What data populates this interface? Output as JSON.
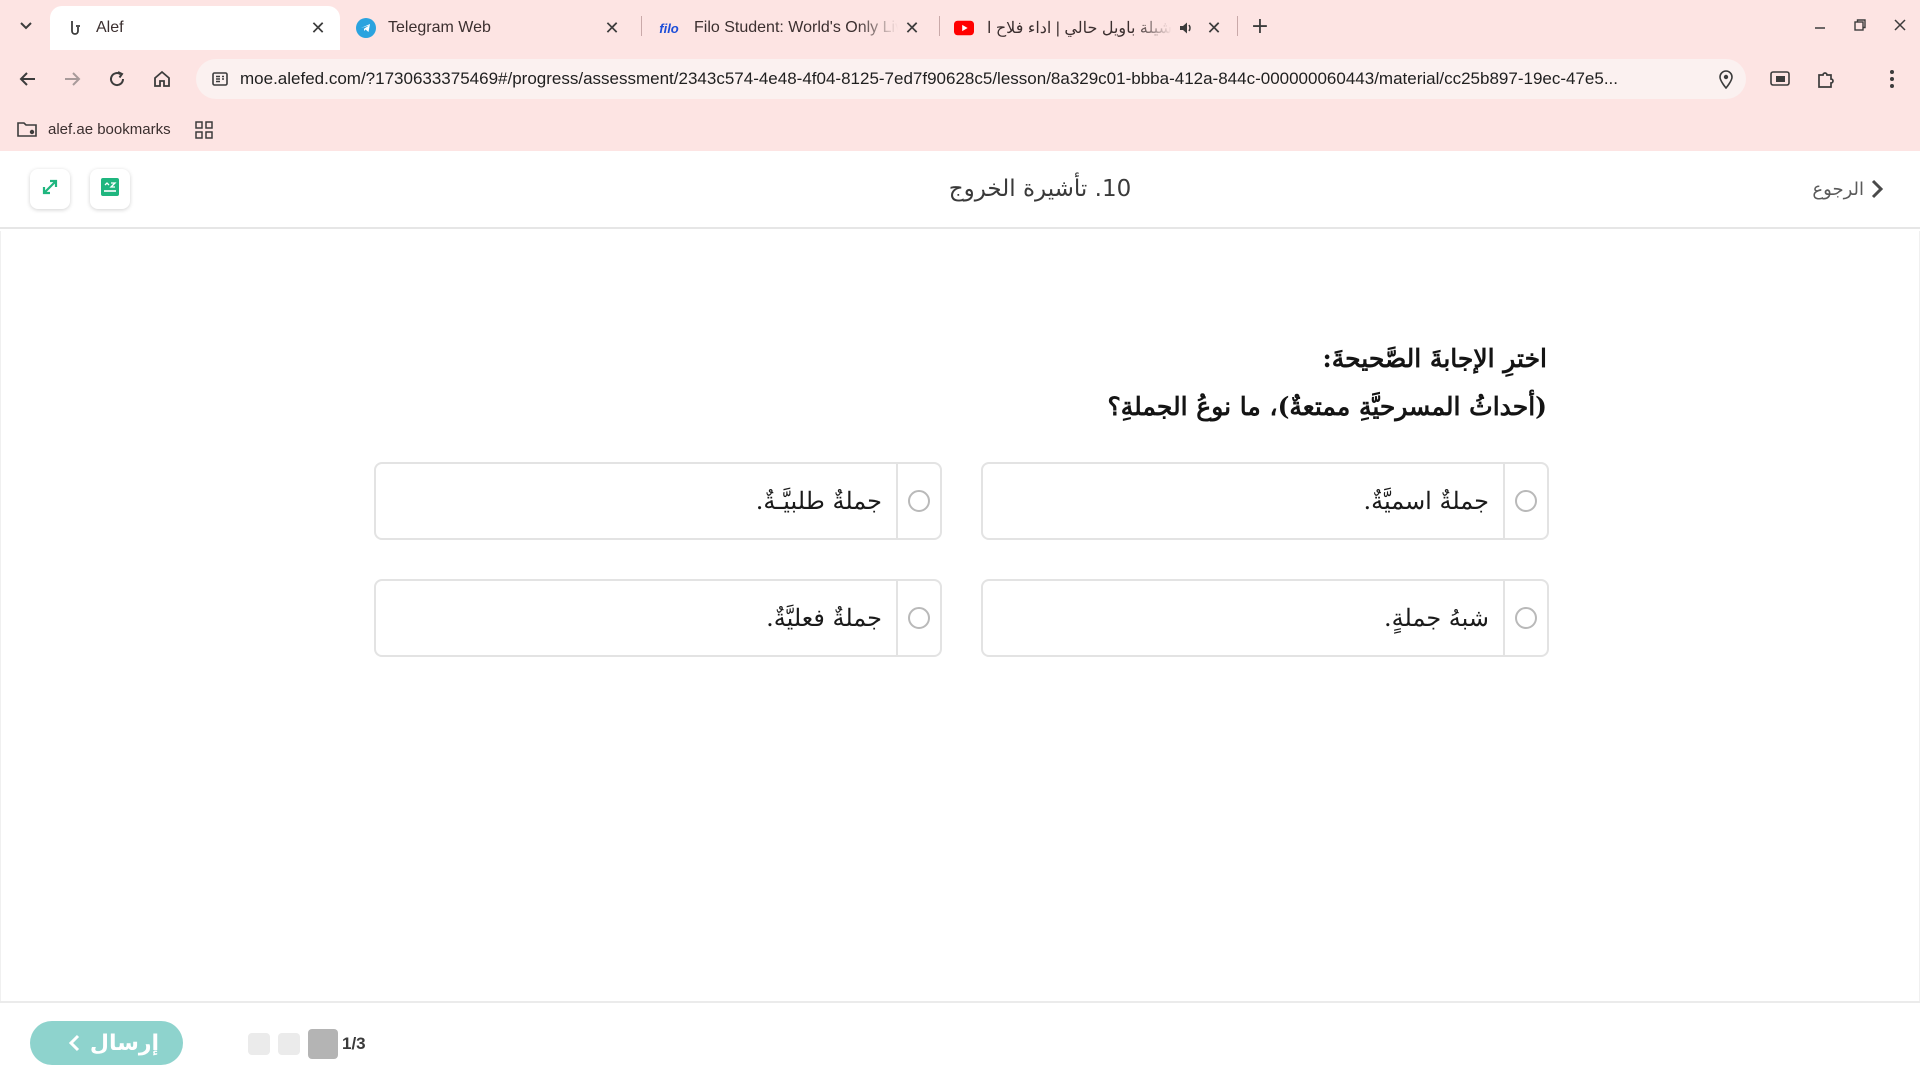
{
  "browser": {
    "tabs": [
      {
        "title": "Alef",
        "icon": "alef-logo-icon",
        "active": true
      },
      {
        "title": "Telegram Web",
        "icon": "telegram-icon",
        "active": false
      },
      {
        "title": "Filo Student: World's Only Live Instant Tutoring",
        "favicon_text": "filo",
        "active": false
      },
      {
        "title": "شيلة باويل حالي | اداء فلاح المسعودي",
        "icon": "youtube-icon",
        "audio": true,
        "active": false
      }
    ],
    "url": "moe.alefed.com/?1730633375469#/progress/assessment/2343c574-4e48-4f04-8125-7ed7f90628c5/lesson/8a329c01-bbba-412a-844c-000000060443/material/cc25b897-19ec-47e5...",
    "bookmarks": [
      {
        "label": "alef.ae bookmarks"
      }
    ],
    "colors": {
      "chrome": "#fde4e3",
      "omnibox": "#fbf1f0"
    }
  },
  "header": {
    "title": "10. تأشيرة الخروج",
    "back_label": "الرجوع"
  },
  "question": {
    "instruction": "اخترِ الإجابةَ الصَّحيحةَ:",
    "prompt": "(أحداثُ المسرحيَّةِ ممتعةٌ)، ما نوعُ الجملةِ؟",
    "options": [
      {
        "text": "جملةٌ اسميَّةٌ."
      },
      {
        "text": "جملةٌ طلبيَّـةٌ."
      },
      {
        "text": "شبهُ جملةٍ."
      },
      {
        "text": "جملةٌ فعليَّةٌ."
      }
    ]
  },
  "footer": {
    "submit_label": "إرسال",
    "page_indicator": "1/3",
    "current_page": 1,
    "total_pages": 3,
    "colors": {
      "submit": "#8ed3cd",
      "accent": "#1fb67f"
    }
  }
}
